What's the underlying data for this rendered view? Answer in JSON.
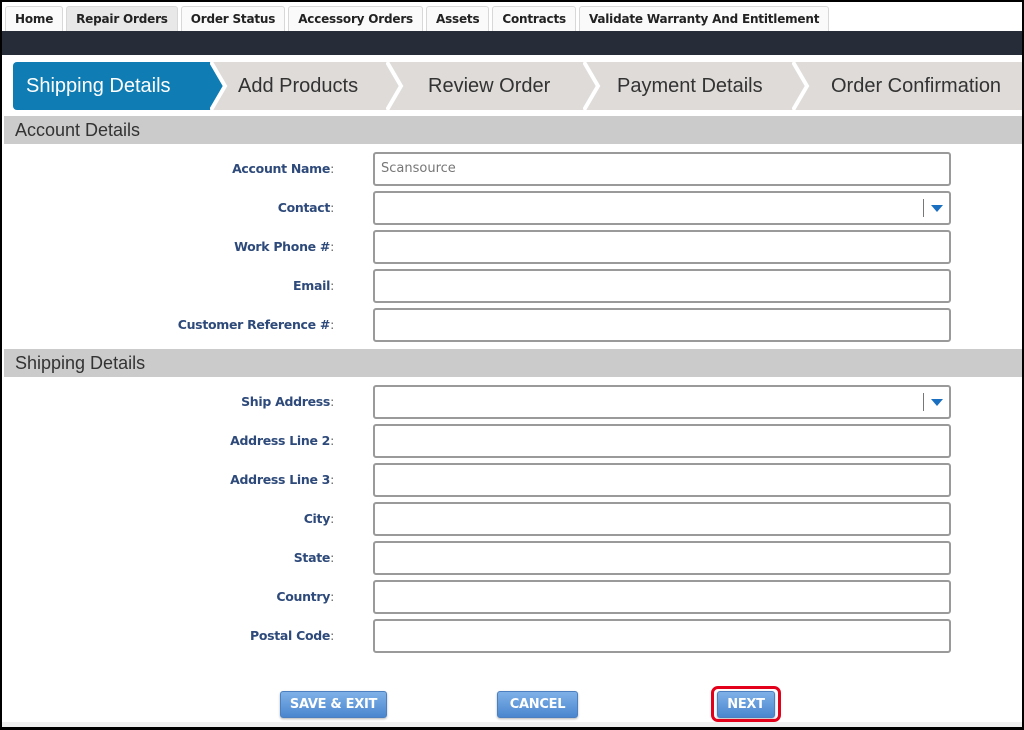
{
  "top_tabs": [
    {
      "label": "Home",
      "active": false
    },
    {
      "label": "Repair Orders",
      "active": true
    },
    {
      "label": "Order Status",
      "active": false
    },
    {
      "label": "Accessory Orders",
      "active": false
    },
    {
      "label": "Assets",
      "active": false
    },
    {
      "label": "Contracts",
      "active": false
    },
    {
      "label": "Validate Warranty And Entitlement",
      "active": false
    }
  ],
  "wizard": {
    "current_step": "Shipping Details",
    "steps": [
      "Shipping Details",
      "Add Products",
      "Review Order",
      "Payment Details",
      "Order Confirmation"
    ]
  },
  "account_section": {
    "title": "Account Details",
    "fields": [
      {
        "label": "Account Name",
        "value": "Scansource",
        "type": "text"
      },
      {
        "label": "Contact",
        "value": "",
        "type": "select"
      },
      {
        "label": "Work Phone #",
        "value": "",
        "type": "text"
      },
      {
        "label": "Email",
        "value": "",
        "type": "text"
      },
      {
        "label": "Customer Reference #",
        "value": "",
        "type": "text"
      }
    ]
  },
  "shipping_section": {
    "title": "Shipping Details",
    "fields": [
      {
        "label": "Ship Address",
        "value": "",
        "type": "select"
      },
      {
        "label": "Address Line 2",
        "value": "",
        "type": "text"
      },
      {
        "label": "Address Line 3",
        "value": "",
        "type": "text"
      },
      {
        "label": "City",
        "value": "",
        "type": "text"
      },
      {
        "label": "State",
        "value": "",
        "type": "text"
      },
      {
        "label": "Country",
        "value": "",
        "type": "text"
      },
      {
        "label": "Postal Code",
        "value": "",
        "type": "text"
      }
    ]
  },
  "colon": ":",
  "buttons": {
    "save_exit": "SAVE & EXIT",
    "cancel": "CANCEL",
    "next": "NEXT"
  },
  "colors": {
    "active_step": "#0f7db3",
    "label_text": "#2e4a7a",
    "button": "#5a95d9",
    "highlight": "#e3001b",
    "dark_bar": "#262c38"
  }
}
